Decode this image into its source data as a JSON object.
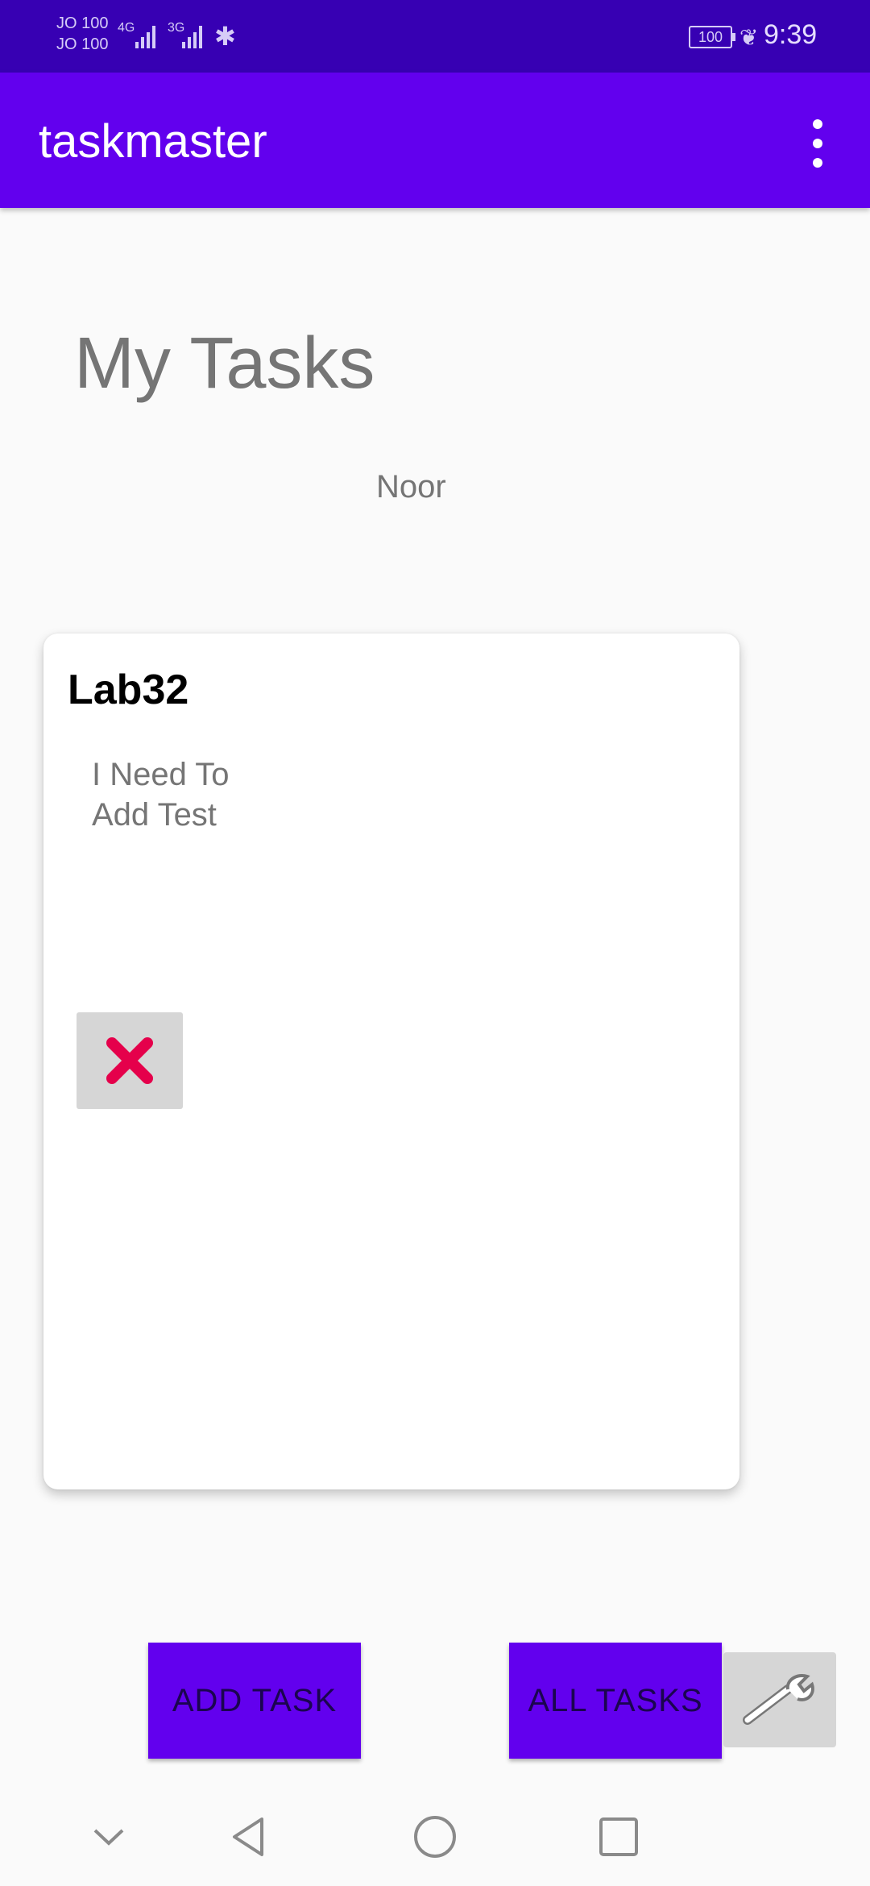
{
  "status_bar": {
    "carrier_1": "JO 100",
    "carrier_2": "JO 100",
    "network_1": "4G",
    "network_2": "3G",
    "battery": "100",
    "time": "9:39"
  },
  "app_bar": {
    "title": "taskmaster"
  },
  "main": {
    "page_title": "My Tasks",
    "user_name": "Noor"
  },
  "task": {
    "title": "Lab32",
    "body": "I Need To Add Test"
  },
  "buttons": {
    "add_task": "ADD TASK",
    "all_tasks": "ALL TASKS"
  },
  "colors": {
    "status_bar": "#3700b3",
    "app_bar": "#6200ee",
    "primary_button": "#6200ee",
    "delete_icon": "#e5004b"
  },
  "icons": {
    "overflow": "more-vert-icon",
    "delete": "close-icon",
    "settings": "wrench-icon",
    "nav": [
      "chevron-down-icon",
      "back-triangle-icon",
      "home-circle-icon",
      "recents-square-icon"
    ]
  }
}
